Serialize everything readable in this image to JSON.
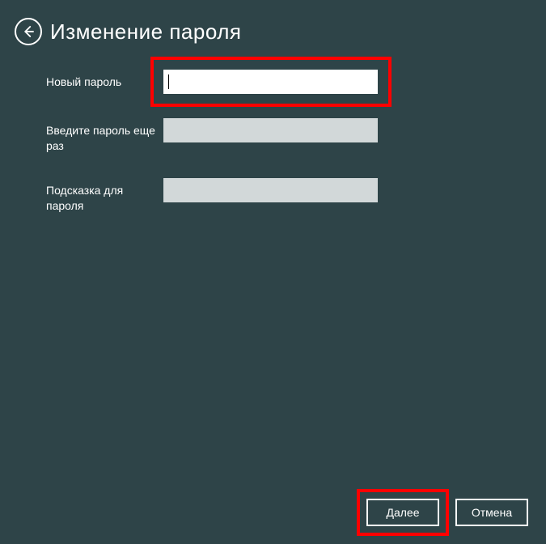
{
  "header": {
    "title": "Изменение пароля"
  },
  "form": {
    "new_password_label": "Новый пароль",
    "repeat_password_label": "Введите пароль еще раз",
    "hint_label": "Подсказка для пароля"
  },
  "buttons": {
    "next": "Далее",
    "cancel": "Отмена"
  }
}
